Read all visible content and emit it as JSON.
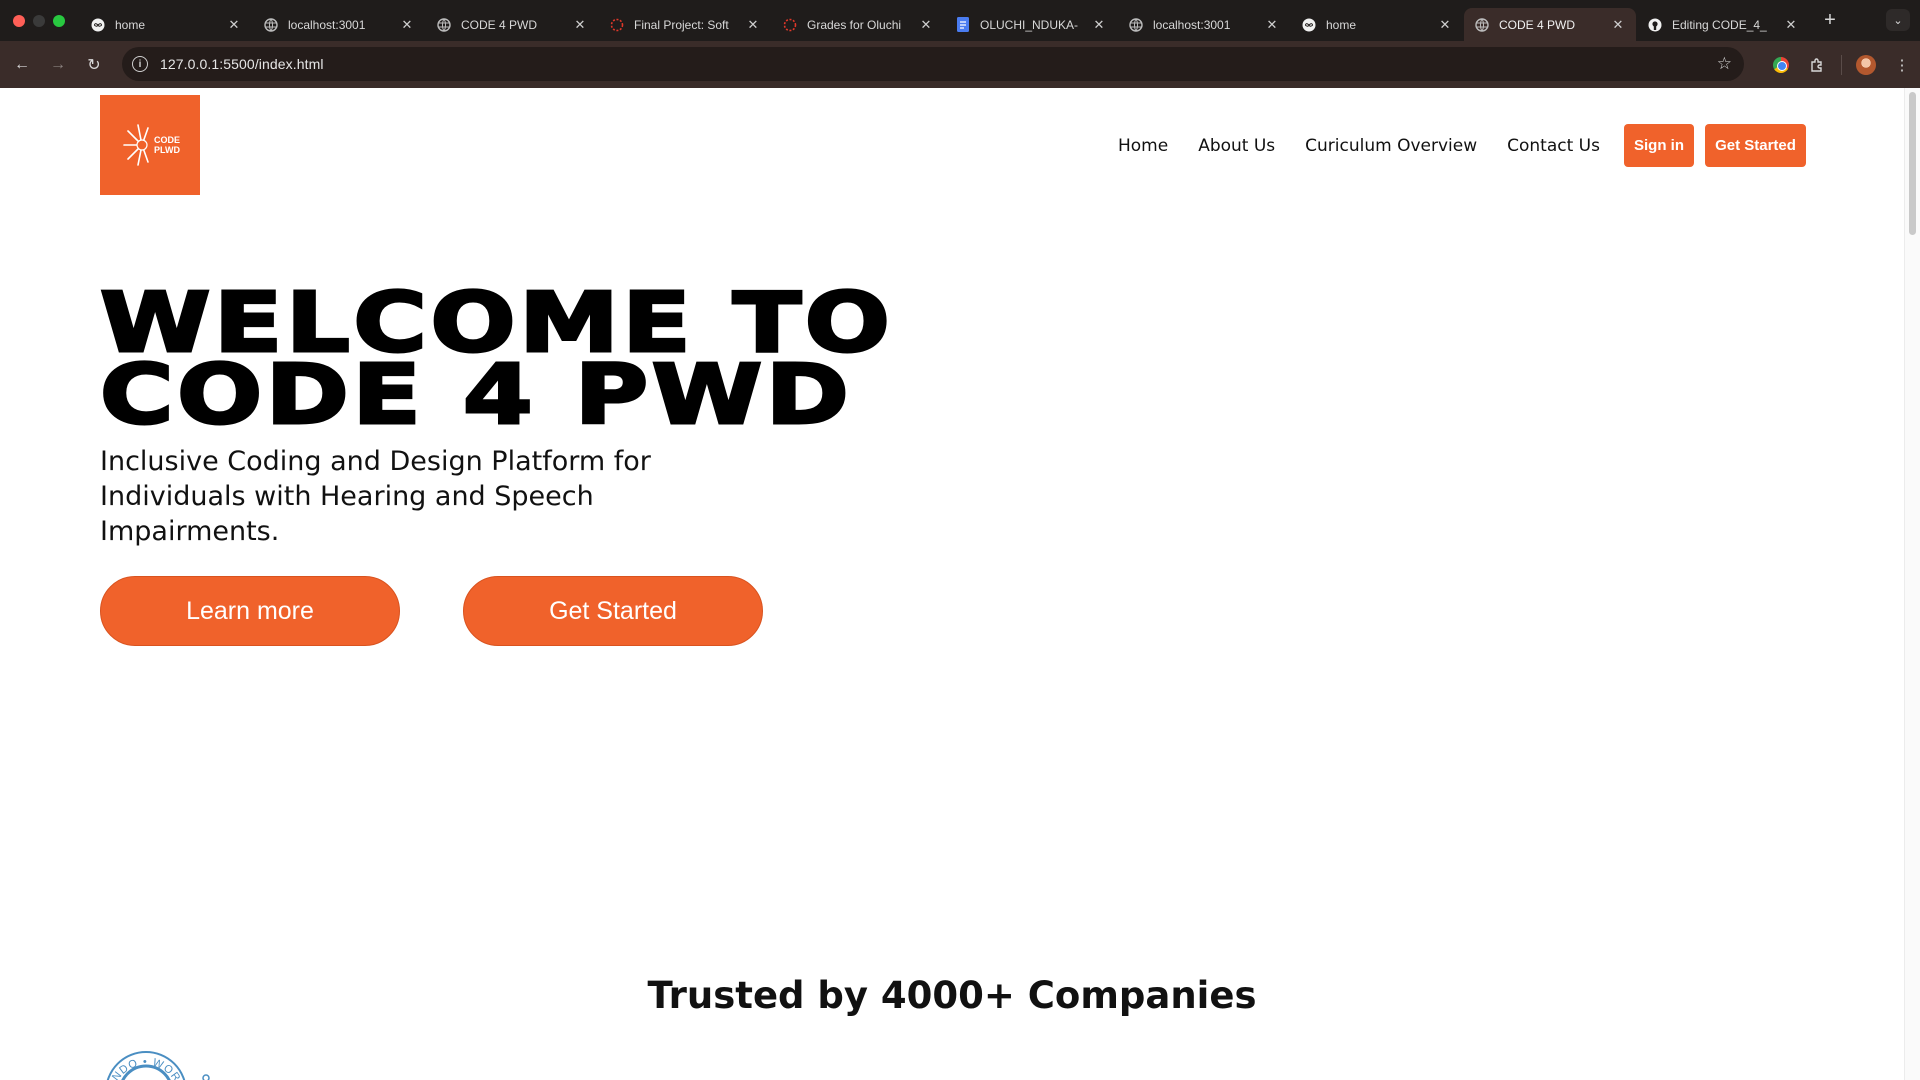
{
  "browser": {
    "tabs": [
      {
        "title": "home",
        "icon": "infinity-icon",
        "active": false
      },
      {
        "title": "localhost:3001",
        "icon": "globe-icon",
        "active": false
      },
      {
        "title": "CODE 4 PWD",
        "icon": "globe-icon",
        "active": false
      },
      {
        "title": "Final Project: Soft",
        "icon": "spinner-icon",
        "active": false
      },
      {
        "title": "Grades for Oluchi",
        "icon": "spinner-icon",
        "active": false
      },
      {
        "title": "OLUCHI_NDUKA-",
        "icon": "docs-icon",
        "active": false
      },
      {
        "title": "localhost:3001",
        "icon": "globe-icon",
        "active": false
      },
      {
        "title": "home",
        "icon": "infinity-icon",
        "active": false
      },
      {
        "title": "CODE 4 PWD",
        "icon": "globe-icon",
        "active": true
      },
      {
        "title": "Editing CODE_4_",
        "icon": "github-icon",
        "active": false
      }
    ],
    "url": "127.0.0.1:5500/index.html"
  },
  "site": {
    "logo": {
      "line1": "CODE",
      "line2": "PLWD"
    },
    "nav": [
      "Home",
      "About Us",
      "Curiculum Overview",
      "Contact Us"
    ],
    "signin_label": "Sign in",
    "get_started_label": "Get Started"
  },
  "hero": {
    "title_line1": "WELCOME TO",
    "title_line2": "CODE 4 PWD",
    "subtitle": "Inclusive Coding and Design Platform for Individuals with Hearing and Speech Impairments.",
    "learn_more_label": "Learn more",
    "get_started_label": "Get Started"
  },
  "trusted": {
    "heading": "Trusted by 4000+ Companies",
    "partner_logo_text": "UNDO • WORL"
  },
  "colors": {
    "accent": "#f0622b",
    "chrome_bg": "#1f1c1b",
    "toolbar_bg": "#3a2c29"
  }
}
